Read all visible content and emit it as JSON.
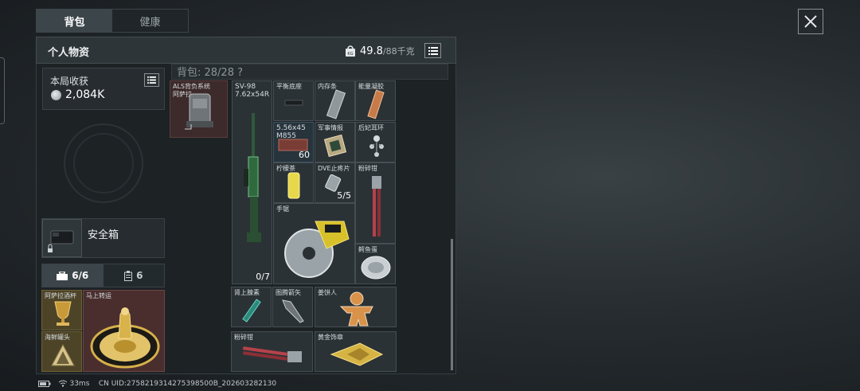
{
  "tabs": [
    {
      "label": "背包"
    },
    {
      "label": "健康"
    }
  ],
  "panel": {
    "title": "个人物资",
    "weight": "49.8",
    "weight_max": "/88千克"
  },
  "earnings": {
    "title": "本局收获",
    "value": "2,084K"
  },
  "bag": {
    "header": "背包: 28/28 ?"
  },
  "safe": {
    "label": "安全箱"
  },
  "sub_tabs": [
    {
      "label": "6/6"
    },
    {
      "label": "6"
    }
  ],
  "equipment": {
    "backpack_name": "ALS背负系统\n阿萨拉..."
  },
  "items": {
    "rifle": {
      "name": "SV-98\n7.62x54R",
      "count": "0/7"
    },
    "balance_base": {
      "name": "平衡底座"
    },
    "memory_stick": {
      "name": "内存条"
    },
    "energy_gel": {
      "name": "能量凝胶"
    },
    "ammo": {
      "name": "5.56x45\nM855",
      "count": "60"
    },
    "intel": {
      "name": "军事情报"
    },
    "earring": {
      "name": "后妃耳环"
    },
    "lemon_tea": {
      "name": "柠檬茶"
    },
    "dve": {
      "name": "DVE止疼片",
      "count": "5/5"
    },
    "crusher_pliers_1": {
      "name": "粉碎钳"
    },
    "saw": {
      "name": "手锯"
    },
    "crocodile_egg": {
      "name": "鳄鱼蛋"
    },
    "adrenaline": {
      "name": "肾上腺素"
    },
    "totem_arrow": {
      "name": "图腾箭矢"
    },
    "gingerbread": {
      "name": "姜饼人"
    },
    "crusher_pliers_2": {
      "name": "粉碎钳"
    },
    "gold_medal": {
      "name": "黄金饰章"
    }
  },
  "safe_items": {
    "cup": {
      "name": "阿萨拉酒杯"
    },
    "fortune": {
      "name": "马上转运"
    },
    "can": {
      "name": "海鲜罐头"
    }
  },
  "status": {
    "ping": "33ms",
    "uid": "CN UID:2758219314275398500B_202603282130"
  },
  "colors": {
    "panel": "#1d2225",
    "slot": "#2b3236",
    "red_slot": "#4a2e2e",
    "gold_slot": "#4d4428"
  }
}
